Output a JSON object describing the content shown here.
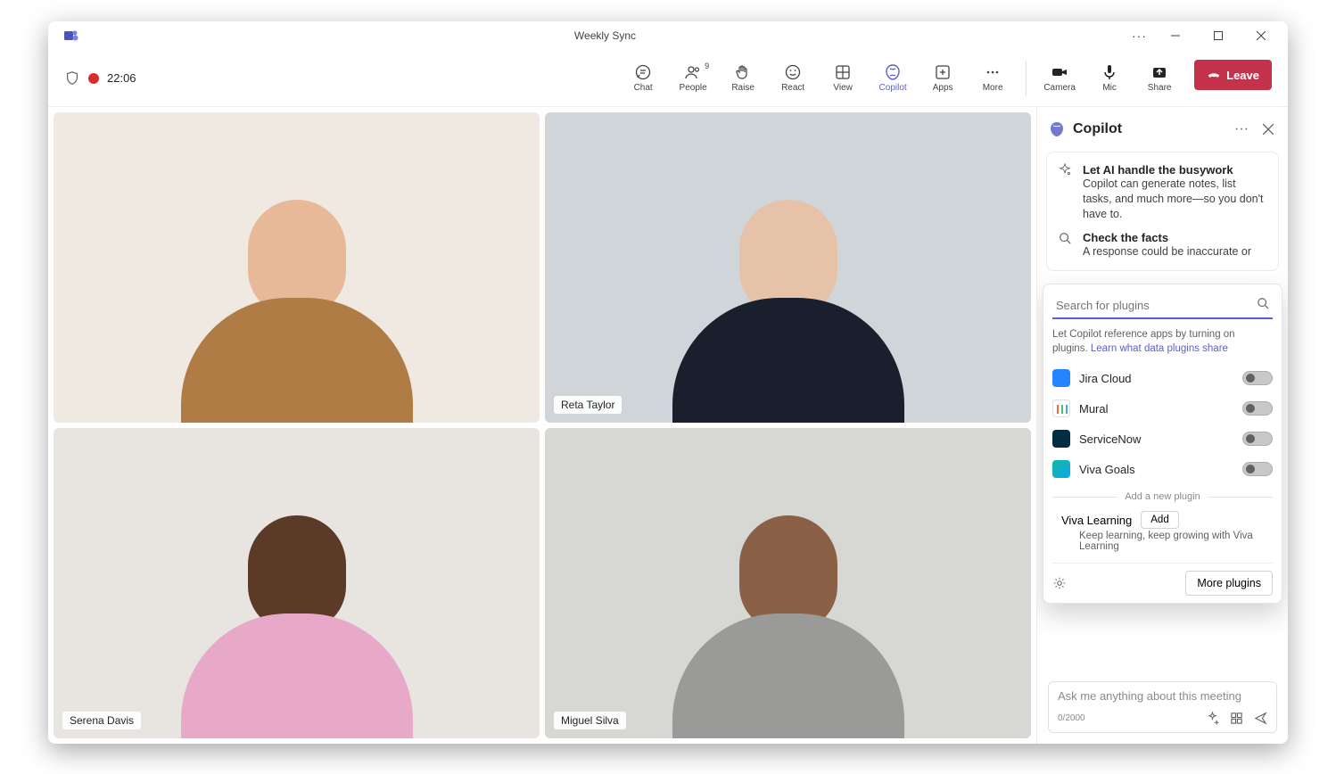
{
  "titlebar": {
    "title": "Weekly Sync"
  },
  "toolbar": {
    "timer": "22:06",
    "chat": "Chat",
    "people": "People",
    "people_count": "9",
    "raise": "Raise",
    "react": "React",
    "view": "View",
    "copilot": "Copilot",
    "apps": "Apps",
    "more": "More",
    "camera": "Camera",
    "mic": "Mic",
    "share": "Share",
    "leave": "Leave"
  },
  "participants": [
    {
      "name": ""
    },
    {
      "name": "Reta Taylor"
    },
    {
      "name": "Serena Davis"
    },
    {
      "name": "Miguel Silva"
    }
  ],
  "sidepanel": {
    "title": "Copilot",
    "tips": [
      {
        "head": "Let AI handle the busywork",
        "body": "Copilot can generate notes, list tasks, and much more—so you don't have to."
      },
      {
        "head": "Check the facts",
        "body": "A response could be inaccurate or"
      }
    ],
    "popover": {
      "search_placeholder": "Search for plugins",
      "hint_pre": "Let Copilot reference apps by turning on plugins.  ",
      "hint_link": "Learn what data plugins share",
      "plugins": [
        {
          "name": "Jira Cloud",
          "color": "#2684ff"
        },
        {
          "name": "Mural",
          "color": "#ffffff"
        },
        {
          "name": "ServiceNow",
          "color": "#032d42"
        },
        {
          "name": "Viva Goals",
          "color": "#14b8a6"
        }
      ],
      "divider": "Add a new plugin",
      "new_plugin": {
        "name": "Viva Learning",
        "add": "Add",
        "desc": "Keep learning, keep growing with Viva Learning"
      },
      "more_plugins": "More plugins"
    },
    "compose": {
      "placeholder": "Ask me anything about this meeting",
      "counter": "0/2000"
    }
  }
}
